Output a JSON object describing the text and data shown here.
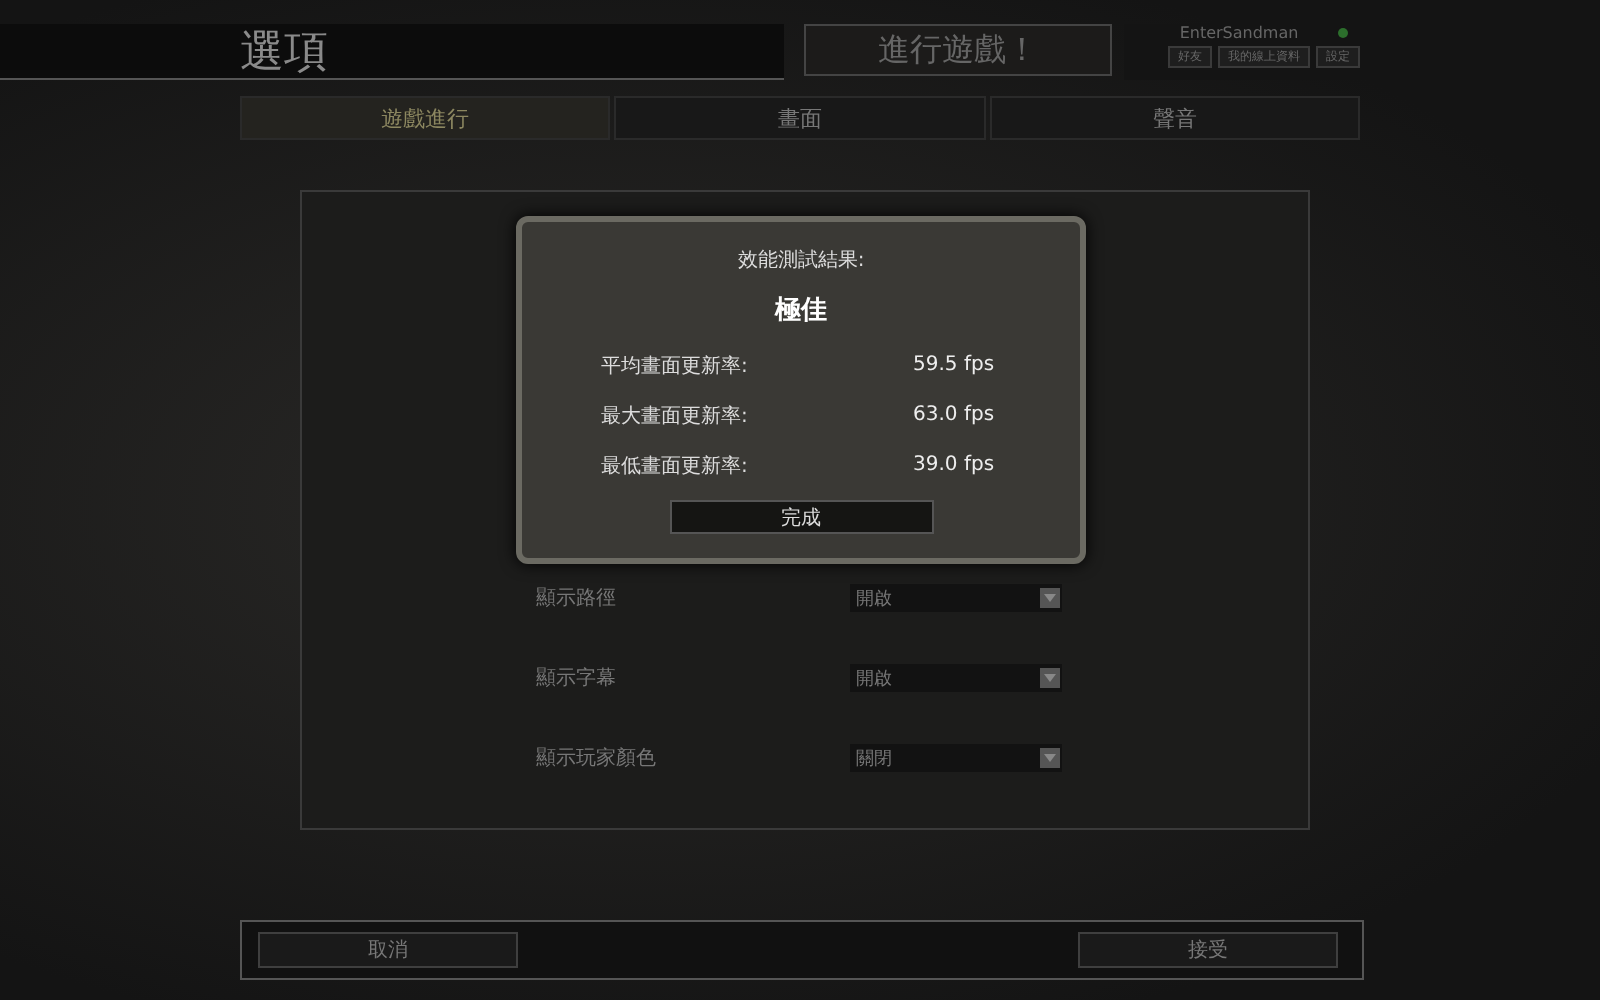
{
  "header": {
    "title": "選項",
    "play_button": "進行遊戲！"
  },
  "user_panel": {
    "username": "EnterSandman",
    "online": true,
    "buttons": [
      "好友",
      "我的線上資料",
      "設定"
    ]
  },
  "tabs": [
    {
      "label": "遊戲進行",
      "selected": true
    },
    {
      "label": "畫面",
      "selected": false
    },
    {
      "label": "聲音",
      "selected": false
    }
  ],
  "settings": [
    {
      "label": "顯示路徑",
      "value": "開啟"
    },
    {
      "label": "顯示字幕",
      "value": "開啟"
    },
    {
      "label": "顯示玩家顏色",
      "value": "關閉"
    }
  ],
  "dialog": {
    "title": "效能測試結果:",
    "rating": "極佳",
    "rows": [
      {
        "label": "平均畫面更新率:",
        "value": "59.5 fps"
      },
      {
        "label": "最大畫面更新率:",
        "value": "63.0 fps"
      },
      {
        "label": "最低畫面更新率:",
        "value": "39.0 fps"
      }
    ],
    "button": "完成"
  },
  "footer": {
    "cancel": "取消",
    "accept": "接受"
  }
}
